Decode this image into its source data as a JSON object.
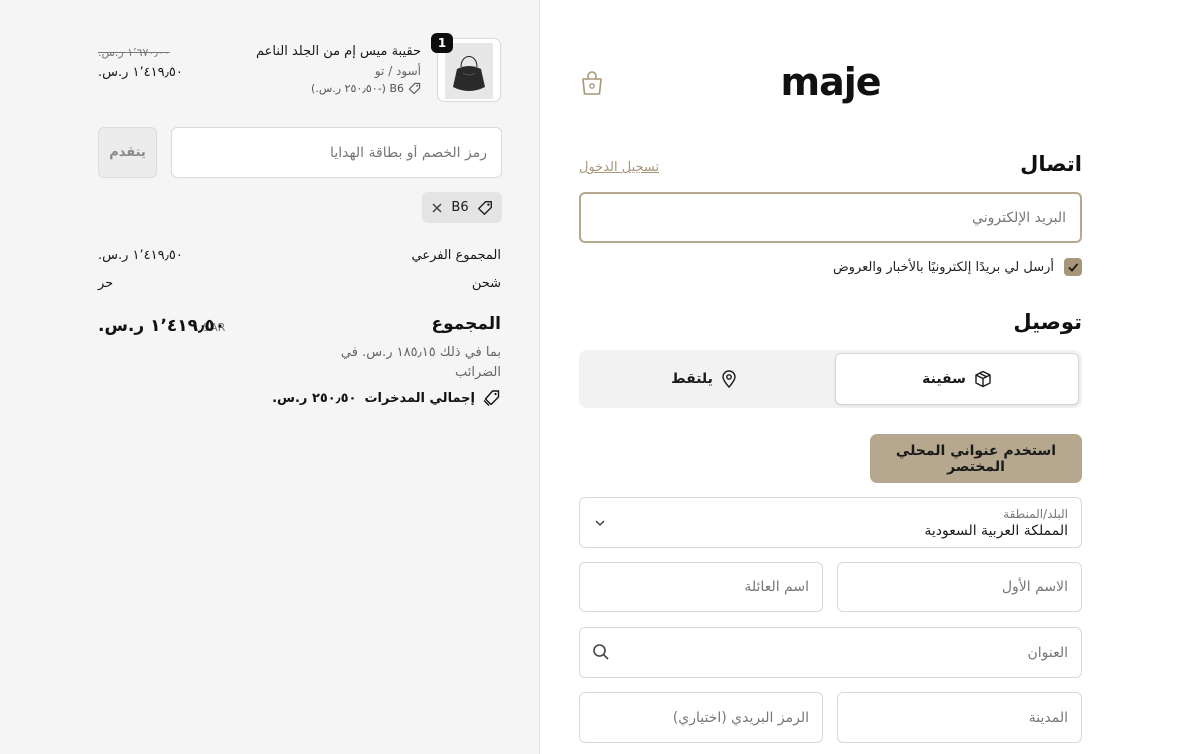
{
  "brand": {
    "logo_text": "maje"
  },
  "contact": {
    "title": "اتصال",
    "login_link": "تسجيل الدخول",
    "email_placeholder": "البريد الإلكتروني",
    "newsletter_label": "أرسل لي بريدًا إلكترونيًا بالأخبار والعروض",
    "newsletter_checked": true
  },
  "delivery": {
    "title": "توصيل",
    "options": [
      {
        "label": "سفينة",
        "icon": "package-icon",
        "selected": true
      },
      {
        "label": "يلتقط",
        "icon": "location-pin-icon",
        "selected": false
      }
    ],
    "shortcut_button": "استخدم عنواني المحلي المختصر",
    "country_label": "البلد/المنطقة",
    "country_value": "المملكة العربية السعودية",
    "first_name_placeholder": "الاسم الأول",
    "last_name_placeholder": "اسم العائلة",
    "address_placeholder": "العنوان",
    "city_placeholder": "المدينة",
    "postal_placeholder": "الرمز البريدي (اختياري)"
  },
  "summary": {
    "product": {
      "name": "حقيبة ميس إم من الجلد الناعم",
      "variant": "أسود / تو",
      "discount_line": "B6 (-٢٥٠٫٥٠ ر.س.)",
      "quantity": "1",
      "price_old": "١٬٦٧٠٫٠٠ ر.س.",
      "price_new": "١٬٤١٩٫٥٠ ر.س."
    },
    "discount_placeholder": "رمز الخصم أو بطاقة الهدايا",
    "apply_label": "يتقدم",
    "applied_code": "B6",
    "subtotal_label": "المجموع الفرعي",
    "subtotal_value": "١٬٤١٩٫٥٠ ر.س.",
    "shipping_label": "شحن",
    "shipping_value": "حر",
    "total_label": "المجموع",
    "currency": "SAR",
    "total_value": "١٬٤١٩٫٥٠ ر.س.",
    "tax_note": "بما في ذلك ١٨٥٫١٥ ر.س. في الضرائب",
    "savings_label": "إجمالي المدخرات",
    "savings_value": "٢٥٠٫٥٠ ر.س."
  },
  "colors": {
    "accent": "#b5a88e",
    "link": "#a8967a",
    "summary_bg": "#f5f5f5"
  }
}
